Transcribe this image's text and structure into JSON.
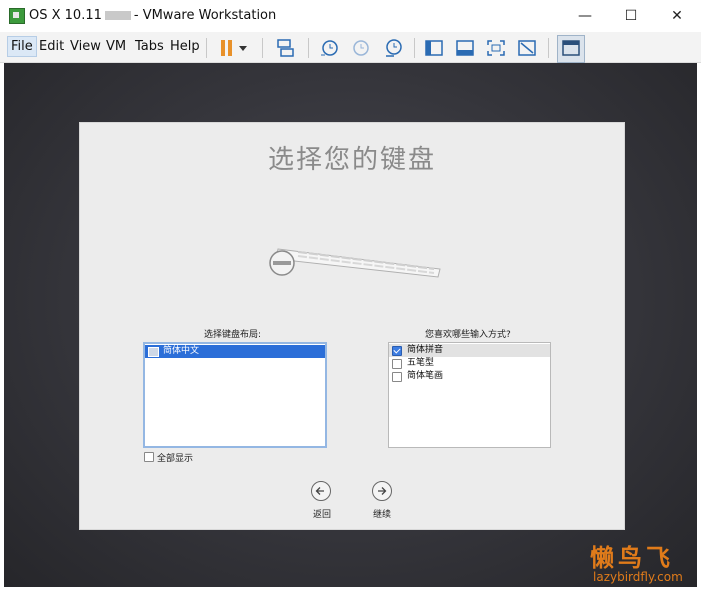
{
  "window": {
    "title_prefix": "OS X 10.11",
    "title_suffix": "- VMware Workstation",
    "controls": {
      "minimize": "—",
      "maximize": "☐",
      "close": "✕"
    }
  },
  "menu": [
    "File",
    "Edit",
    "View",
    "VM",
    "Tabs",
    "Help"
  ],
  "toolbar_icons": [
    "pause-icon",
    "dropdown-arrow-icon",
    "send-keys-icon",
    "snapshot-take-icon",
    "snapshot-revert-icon",
    "snapshot-manager-icon",
    "show-library-icon",
    "fit-guest-icon",
    "fullscreen-icon",
    "unity-icon",
    "console-view-icon"
  ],
  "setup": {
    "title": "选择您的键盘",
    "layout_label": "选择键盘布局:",
    "layouts": [
      "简体中文"
    ],
    "show_all_label": "全部显示",
    "input_label": "您喜欢哪些输入方式?",
    "input_methods": [
      {
        "label": "简体拼音",
        "checked": true
      },
      {
        "label": "五笔型",
        "checked": false
      },
      {
        "label": "简体笔画",
        "checked": false
      }
    ],
    "back_label": "返回",
    "continue_label": "继续"
  },
  "watermark": {
    "logo": "懒鸟飞",
    "url": "lazybirdfly.com"
  },
  "colors": {
    "accent": "#2b6ed8",
    "vm_background": "#35353b",
    "watermark": "#e07b1a"
  }
}
